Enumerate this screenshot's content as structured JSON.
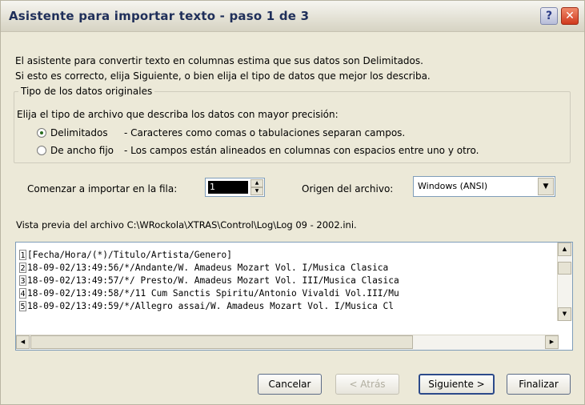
{
  "window": {
    "title": "Asistente para importar texto - paso 1 de 3",
    "help_label": "?",
    "close_label": "✕"
  },
  "intro": {
    "line1": "El asistente para convertir texto en columnas estima que sus datos son Delimitados.",
    "line2": "Si esto es correcto, elija Siguiente, o bien elija el tipo de datos que mejor los describa."
  },
  "original_data_type": {
    "legend": "Tipo de los datos originales",
    "description": "Elija el tipo de archivo que describa los datos con mayor precisión:",
    "options": [
      {
        "label": "Delimitados",
        "description": "- Caracteres como comas o tabulaciones separan campos.",
        "selected": true
      },
      {
        "label": "De ancho fijo",
        "description": "- Los campos están alineados en columnas con espacios entre uno y otro.",
        "selected": false
      }
    ]
  },
  "start_row": {
    "label": "Comenzar a importar en la fila:",
    "value": "1"
  },
  "file_origin": {
    "label": "Origen del archivo:",
    "value": "Windows (ANSI)"
  },
  "preview": {
    "label": "Vista previa del archivo C:\\WRockola\\XTRAS\\Control\\Log\\Log 09 - 2002.ini.",
    "lines": [
      {
        "num": "1",
        "text": "[Fecha/Hora/(*)/Titulo/Artista/Genero]"
      },
      {
        "num": "2",
        "text": "18-09-02/13:49:56/*/Andante/W. Amadeus Mozart Vol. I/Musica Clasica"
      },
      {
        "num": "3",
        "text": "18-09-02/13:49:57/*/ Presto/W. Amadeus Mozart Vol. III/Musica Clasica"
      },
      {
        "num": "4",
        "text": "18-09-02/13:49:58/*/11 Cum Sanctis Spiritu/Antonio Vivaldi Vol.III/Mu"
      },
      {
        "num": "5",
        "text": "18-09-02/13:49:59/*/Allegro assai/W. Amadeus Mozart Vol. I/Musica Cl"
      }
    ]
  },
  "buttons": {
    "cancel": "Cancelar",
    "back": "< Atrás",
    "next": "Siguiente >",
    "finish": "Finalizar"
  },
  "icons": {
    "spin_up": "▲",
    "spin_down": "▼",
    "dropdown": "▼",
    "scroll_up": "▲",
    "scroll_down": "▼",
    "scroll_left": "◀",
    "scroll_right": "▶"
  }
}
